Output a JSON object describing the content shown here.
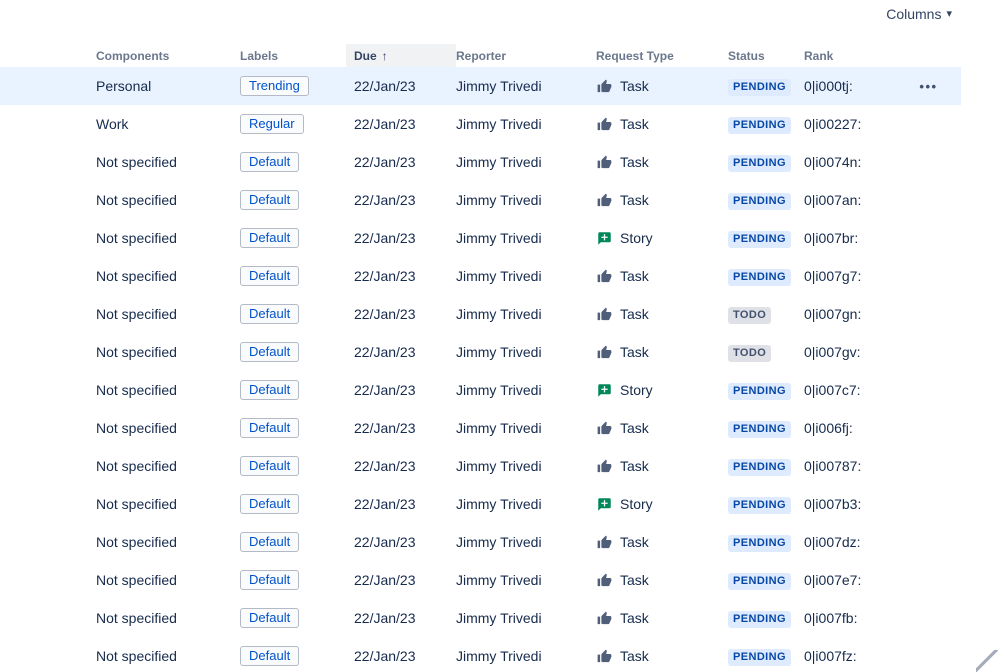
{
  "toolbar": {
    "columns_button": {
      "label": "Columns",
      "chevron_icon": "▾"
    }
  },
  "table": {
    "headers": {
      "components": "Components",
      "labels": "Labels",
      "due": "Due",
      "due_sort_icon": "↑",
      "reporter": "Reporter",
      "request_type": "Request Type",
      "status": "Status",
      "rank": "Rank"
    },
    "row_actions_icon": "•••",
    "status_colors": {
      "PENDING": {
        "bg": "#DEEBFF",
        "fg": "#0747A6"
      },
      "TODO": {
        "bg": "#DFE1E6",
        "fg": "#42526E"
      }
    },
    "request_type_icons": {
      "Task": "thumbs-up-icon",
      "Story": "speech-bubble-icon"
    },
    "icon_colors": {
      "task": "#505F79",
      "story": "#00875A"
    },
    "rows": [
      {
        "components": "Personal",
        "label": "Trending",
        "due": "22/Jan/23",
        "reporter": "Jimmy Trivedi",
        "request_type": "Task",
        "status": "PENDING",
        "rank": "0|i000tj:",
        "selected": true
      },
      {
        "components": "Work",
        "label": "Regular",
        "due": "22/Jan/23",
        "reporter": "Jimmy Trivedi",
        "request_type": "Task",
        "status": "PENDING",
        "rank": "0|i00227:",
        "selected": false
      },
      {
        "components": "Not specified",
        "label": "Default",
        "due": "22/Jan/23",
        "reporter": "Jimmy Trivedi",
        "request_type": "Task",
        "status": "PENDING",
        "rank": "0|i0074n:",
        "selected": false
      },
      {
        "components": "Not specified",
        "label": "Default",
        "due": "22/Jan/23",
        "reporter": "Jimmy Trivedi",
        "request_type": "Task",
        "status": "PENDING",
        "rank": "0|i007an:",
        "selected": false
      },
      {
        "components": "Not specified",
        "label": "Default",
        "due": "22/Jan/23",
        "reporter": "Jimmy Trivedi",
        "request_type": "Story",
        "status": "PENDING",
        "rank": "0|i007br:",
        "selected": false
      },
      {
        "components": "Not specified",
        "label": "Default",
        "due": "22/Jan/23",
        "reporter": "Jimmy Trivedi",
        "request_type": "Task",
        "status": "PENDING",
        "rank": "0|i007g7:",
        "selected": false
      },
      {
        "components": "Not specified",
        "label": "Default",
        "due": "22/Jan/23",
        "reporter": "Jimmy Trivedi",
        "request_type": "Task",
        "status": "TODO",
        "rank": "0|i007gn:",
        "selected": false
      },
      {
        "components": "Not specified",
        "label": "Default",
        "due": "22/Jan/23",
        "reporter": "Jimmy Trivedi",
        "request_type": "Task",
        "status": "TODO",
        "rank": "0|i007gv:",
        "selected": false
      },
      {
        "components": "Not specified",
        "label": "Default",
        "due": "22/Jan/23",
        "reporter": "Jimmy Trivedi",
        "request_type": "Story",
        "status": "PENDING",
        "rank": "0|i007c7:",
        "selected": false
      },
      {
        "components": "Not specified",
        "label": "Default",
        "due": "22/Jan/23",
        "reporter": "Jimmy Trivedi",
        "request_type": "Task",
        "status": "PENDING",
        "rank": "0|i006fj:",
        "selected": false
      },
      {
        "components": "Not specified",
        "label": "Default",
        "due": "22/Jan/23",
        "reporter": "Jimmy Trivedi",
        "request_type": "Task",
        "status": "PENDING",
        "rank": "0|i00787:",
        "selected": false
      },
      {
        "components": "Not specified",
        "label": "Default",
        "due": "22/Jan/23",
        "reporter": "Jimmy Trivedi",
        "request_type": "Story",
        "status": "PENDING",
        "rank": "0|i007b3:",
        "selected": false
      },
      {
        "components": "Not specified",
        "label": "Default",
        "due": "22/Jan/23",
        "reporter": "Jimmy Trivedi",
        "request_type": "Task",
        "status": "PENDING",
        "rank": "0|i007dz:",
        "selected": false
      },
      {
        "components": "Not specified",
        "label": "Default",
        "due": "22/Jan/23",
        "reporter": "Jimmy Trivedi",
        "request_type": "Task",
        "status": "PENDING",
        "rank": "0|i007e7:",
        "selected": false
      },
      {
        "components": "Not specified",
        "label": "Default",
        "due": "22/Jan/23",
        "reporter": "Jimmy Trivedi",
        "request_type": "Task",
        "status": "PENDING",
        "rank": "0|i007fb:",
        "selected": false
      },
      {
        "components": "Not specified",
        "label": "Default",
        "due": "22/Jan/23",
        "reporter": "Jimmy Trivedi",
        "request_type": "Task",
        "status": "PENDING",
        "rank": "0|i007fz:",
        "selected": false
      }
    ]
  }
}
